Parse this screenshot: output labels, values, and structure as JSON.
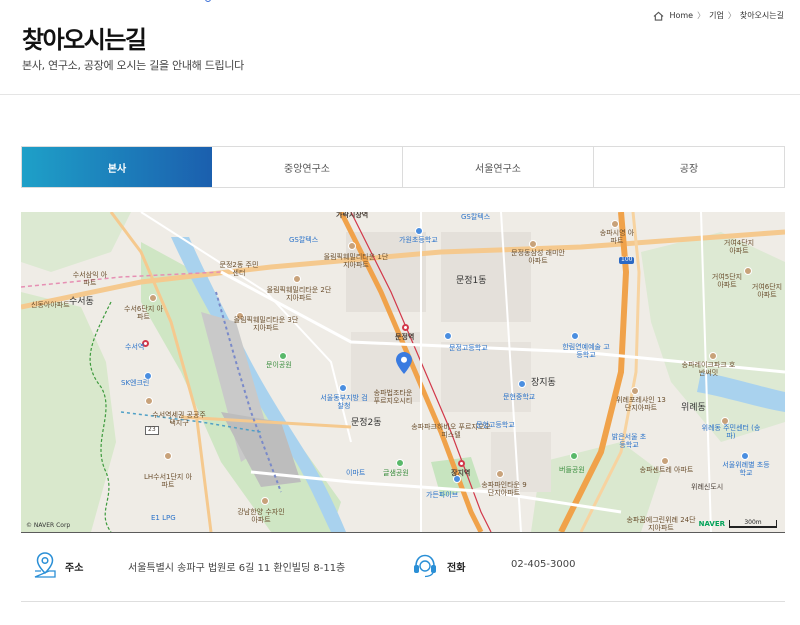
{
  "header": {
    "title": "찾아오시는길",
    "subtitle": "본사, 연구소, 공장에 오시는 길을 안내해 드립니다",
    "breadcrumb": [
      "Home",
      "기업",
      "찾아오시는길"
    ]
  },
  "tabs": [
    {
      "label": "본사",
      "active": true
    },
    {
      "label": "중앙연구소",
      "active": false
    },
    {
      "label": "서울연구소",
      "active": false
    },
    {
      "label": "공장",
      "active": false
    }
  ],
  "map": {
    "labels": {
      "moonjeong1dong": "문정1동",
      "moonjeong2dong": "문정2동",
      "jangjidong": "장지동",
      "wiryedong": "위례동",
      "suseodong": "수서동",
      "moonjeong_station": "문정역",
      "jangji_station": "장지역",
      "suseo_station": "수서역",
      "gs_caltex_1": "GS칼텍스",
      "gs_caltex_2": "GS칼텍스",
      "garak_market": "가락시장역",
      "olympic_1": "올림픽훼밀리타운 1단지아파트",
      "olympic_2": "올림픽훼밀리타운 2단지아파트",
      "olympic_3": "올림픽훼밀리타운 3단지아파트",
      "moonjeong2_center": "문정2동 주민센터",
      "garak_elem": "가원초등학교",
      "moonjeong_samsung": "문정동삼성 래미안아파트",
      "moonjeong_high": "문정고등학교",
      "hanlim_school": "한림연예예술 고등학교",
      "songpa_parkhabio": "송파파크하비오 푸르지오오피스텔",
      "songpa_court": "서울동부지방 검찰청",
      "songpa_legal": "송파법조타운 푸르지오시티",
      "moonjeong_park": "문이공원",
      "munhyeon_middle": "문현중학교",
      "moonjeong_high2": "문현고등학교",
      "sk_church": "SK엔크린",
      "suseo6": "수서6단지 아파트",
      "suseo_sinan": "신동아아파트",
      "suseo_samik": "수서삼익 아파트",
      "suseo_customs": "수서역세권 공공주택지구",
      "lh_suseo": "LH수서1단지 아파트",
      "e1_lpg": "E1 LPG",
      "gangnam_water": "강남한양 수자인아파트",
      "emart": "이마트",
      "garden_park": "글샘공원",
      "garden_five": "가든파이브",
      "songpa_apt": "송파파인타운 9단지아파트",
      "beodeul_park": "버들공원",
      "wirye_center": "위례동 주민센터 (송파)",
      "wirye_elem": "서울위례별 초등학교",
      "wirye_pos": "위례포레샤인 13단지아파트",
      "songpa_lake": "송파레이크파크 호반써밋",
      "songpa_center": "송파센트레 아파트",
      "songpa_wirye": "송파꿈에그린위례 24단지아파트",
      "wirye_city": "위례신도시",
      "geoyeo4": "거여4단지 아파트",
      "geoyeo5": "거여5단지 아파트",
      "geoyeo6": "거여6단지 아파트",
      "songpa_siyeong": "송파시영 아파트",
      "balgeun_school": "밝은서울 초등학교",
      "road_100": "100",
      "road_23": "23",
      "copyright": "© NAVER Corp",
      "naver": "NAVER",
      "scale": "300m"
    }
  },
  "info": {
    "address_label": "주소",
    "address_value": "서울특별시 송파구 법원로 6길 11 환인빌딩 8-11층",
    "phone_label": "전화",
    "phone_value": "02-405-3000"
  }
}
